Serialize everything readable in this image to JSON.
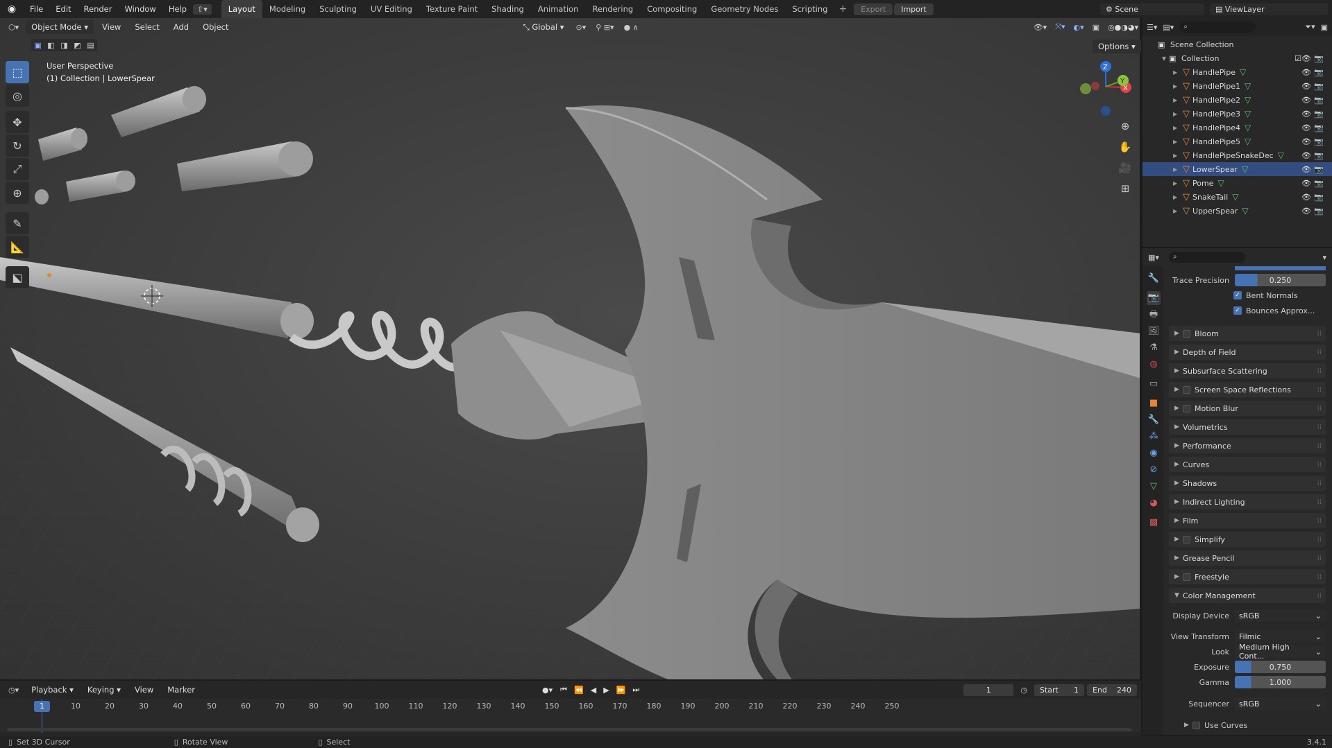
{
  "topbar": {
    "menus": [
      "File",
      "Edit",
      "Render",
      "Window",
      "Help"
    ],
    "workspaces": [
      "Layout",
      "Modeling",
      "Sculpting",
      "UV Editing",
      "Texture Paint",
      "Shading",
      "Animation",
      "Rendering",
      "Compositing",
      "Geometry Nodes",
      "Scripting"
    ],
    "active_workspace": "Layout",
    "export_label": "Export",
    "import_label": "Import",
    "scene": "Scene",
    "view_layer": "ViewLayer"
  },
  "viewport": {
    "mode": "Object Mode",
    "menus": [
      "View",
      "Select",
      "Add",
      "Object"
    ],
    "orientation": "Global",
    "options": "Options",
    "perspective": "User Perspective",
    "context": "(1) Collection | LowerSpear"
  },
  "outliner": {
    "root": "Scene Collection",
    "collection": "Collection",
    "objects": [
      "HandlePipe",
      "HandlePipe1",
      "HandlePipe2",
      "HandlePipe3",
      "HandlePipe4",
      "HandlePipe5",
      "HandlePipeSnakeDec",
      "LowerSpear",
      "Pome",
      "SnakeTail",
      "UpperSpear"
    ],
    "selected": "LowerSpear"
  },
  "properties": {
    "trace_precision_label": "Trace Precision",
    "trace_precision": "0.250",
    "bent_normals": "Bent Normals",
    "bounces_approx": "Bounces Approx...",
    "panels": [
      {
        "label": "Bloom",
        "checkbox": true
      },
      {
        "label": "Depth of Field",
        "checkbox": false
      },
      {
        "label": "Subsurface Scattering",
        "checkbox": false
      },
      {
        "label": "Screen Space Reflections",
        "checkbox": true
      },
      {
        "label": "Motion Blur",
        "checkbox": true
      },
      {
        "label": "Volumetrics",
        "checkbox": false
      },
      {
        "label": "Performance",
        "checkbox": false
      },
      {
        "label": "Curves",
        "checkbox": false
      },
      {
        "label": "Shadows",
        "checkbox": false
      },
      {
        "label": "Indirect Lighting",
        "checkbox": false
      },
      {
        "label": "Film",
        "checkbox": false
      },
      {
        "label": "Simplify",
        "checkbox": true
      },
      {
        "label": "Grease Pencil",
        "checkbox": false
      },
      {
        "label": "Freestyle",
        "checkbox": true
      }
    ],
    "color_management": {
      "label": "Color Management",
      "display_device_label": "Display Device",
      "display_device": "sRGB",
      "view_transform_label": "View Transform",
      "view_transform": "Filmic",
      "look_label": "Look",
      "look": "Medium High Cont...",
      "exposure_label": "Exposure",
      "exposure": "0.750",
      "gamma_label": "Gamma",
      "gamma": "1.000",
      "sequencer_label": "Sequencer",
      "sequencer": "sRGB",
      "use_curves": "Use Curves"
    }
  },
  "timeline": {
    "menus": [
      "Playback",
      "Keying",
      "View",
      "Marker"
    ],
    "current_frame": "1",
    "start_label": "Start",
    "start": "1",
    "end_label": "End",
    "end": "240",
    "ticks": [
      "10",
      "20",
      "30",
      "40",
      "50",
      "60",
      "70",
      "80",
      "90",
      "100",
      "110",
      "120",
      "130",
      "140",
      "150",
      "160",
      "170",
      "180",
      "190",
      "200",
      "210",
      "220",
      "230",
      "240",
      "250"
    ]
  },
  "status": {
    "hint1": "Set 3D Cursor",
    "hint2": "Rotate View",
    "hint3": "Select",
    "version": "3.4.1"
  }
}
